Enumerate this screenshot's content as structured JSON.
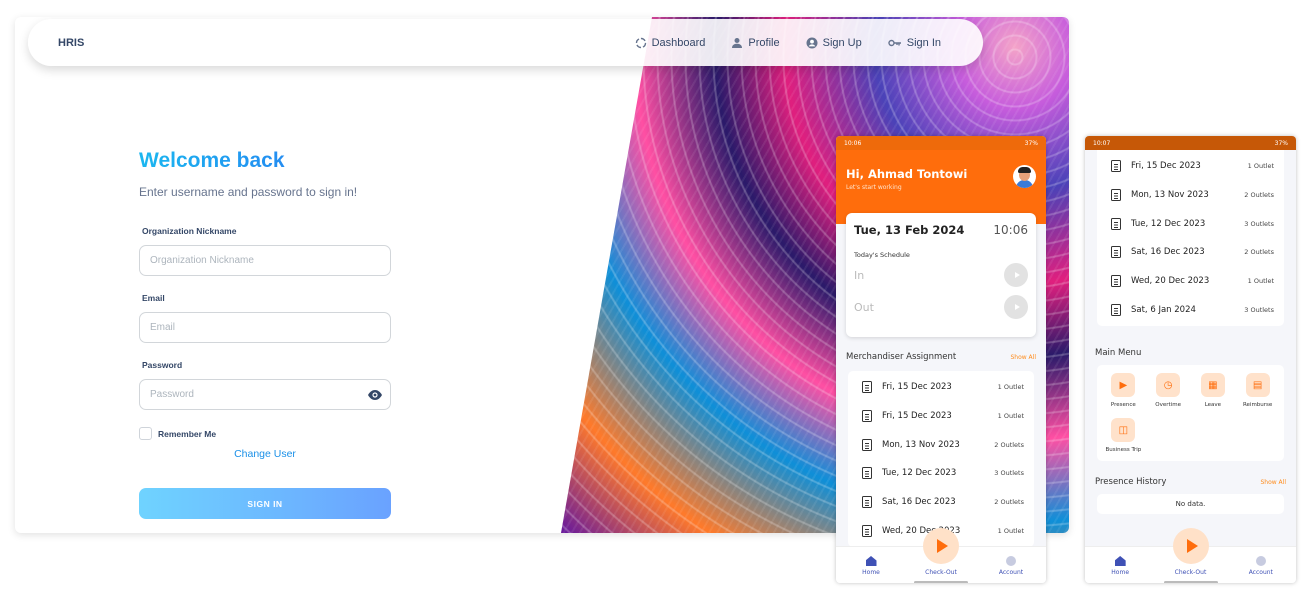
{
  "desktop": {
    "brand": "HRIS",
    "nav": [
      {
        "label": "Dashboard",
        "icon": "dashboard-icon"
      },
      {
        "label": "Profile",
        "icon": "person-icon"
      },
      {
        "label": "Sign Up",
        "icon": "account-circle-icon"
      },
      {
        "label": "Sign In",
        "icon": "key-icon"
      }
    ],
    "title": "Welcome back",
    "subtitle": "Enter username and password to sign in!",
    "org_label": "Organization Nickname",
    "org_placeholder": "Organization Nickname",
    "email_label": "Email",
    "email_placeholder": "Email",
    "password_label": "Password",
    "password_placeholder": "Password",
    "remember_label": "Remember Me",
    "change_user": "Change User",
    "signin_button": "SIGN IN"
  },
  "phone1": {
    "status_time": "10:06",
    "status_right": "37%",
    "greeting": "Hi, Ahmad Tontowi",
    "tagline": "Let's start working",
    "date": "Tue, 13 Feb 2024",
    "time": "10:06",
    "schedule_label": "Today's Schedule",
    "in_label": "In",
    "out_label": "Out",
    "section_title": "Merchandiser Assignment",
    "show_all": "Show All",
    "assignments": [
      {
        "date": "Fri, 15 Dec 2023",
        "count": "1 Outlet"
      },
      {
        "date": "Fri, 15 Dec 2023",
        "count": "1 Outlet"
      },
      {
        "date": "Mon, 13 Nov 2023",
        "count": "2 Outlets"
      },
      {
        "date": "Tue, 12 Dec 2023",
        "count": "3 Outlets"
      },
      {
        "date": "Sat, 16 Dec 2023",
        "count": "2 Outlets"
      },
      {
        "date": "Wed, 20 Dec 2023",
        "count": "1 Outlet"
      }
    ],
    "nav": {
      "home": "Home",
      "checkout": "Check-Out",
      "account": "Account"
    }
  },
  "phone2": {
    "status_time": "10:07",
    "status_right": "37%",
    "assignments": [
      {
        "date": "Fri, 15 Dec 2023",
        "count": "1 Outlet"
      },
      {
        "date": "Mon, 13 Nov 2023",
        "count": "2 Outlets"
      },
      {
        "date": "Tue, 12 Dec 2023",
        "count": "3 Outlets"
      },
      {
        "date": "Sat, 16 Dec 2023",
        "count": "2 Outlets"
      },
      {
        "date": "Wed, 20 Dec 2023",
        "count": "1 Outlet"
      },
      {
        "date": "Sat, 6 Jan 2024",
        "count": "3 Outlets"
      }
    ],
    "main_menu_title": "Main Menu",
    "menu": [
      {
        "label": "Presence",
        "icon": "play-icon"
      },
      {
        "label": "Overtime",
        "icon": "clock-icon"
      },
      {
        "label": "Leave",
        "icon": "calendar-icon"
      },
      {
        "label": "Reimburse",
        "icon": "receipt-icon"
      },
      {
        "label": "Business Trip",
        "icon": "briefcase-icon"
      }
    ],
    "history_title": "Presence History",
    "show_all": "Show All",
    "no_data": "No data.",
    "nav": {
      "home": "Home",
      "checkout": "Check-Out",
      "account": "Account"
    }
  },
  "colors": {
    "accent": "#ff6d0c",
    "brand_blue": "#2a6ef2",
    "nav_blue": "#3f51b5"
  }
}
